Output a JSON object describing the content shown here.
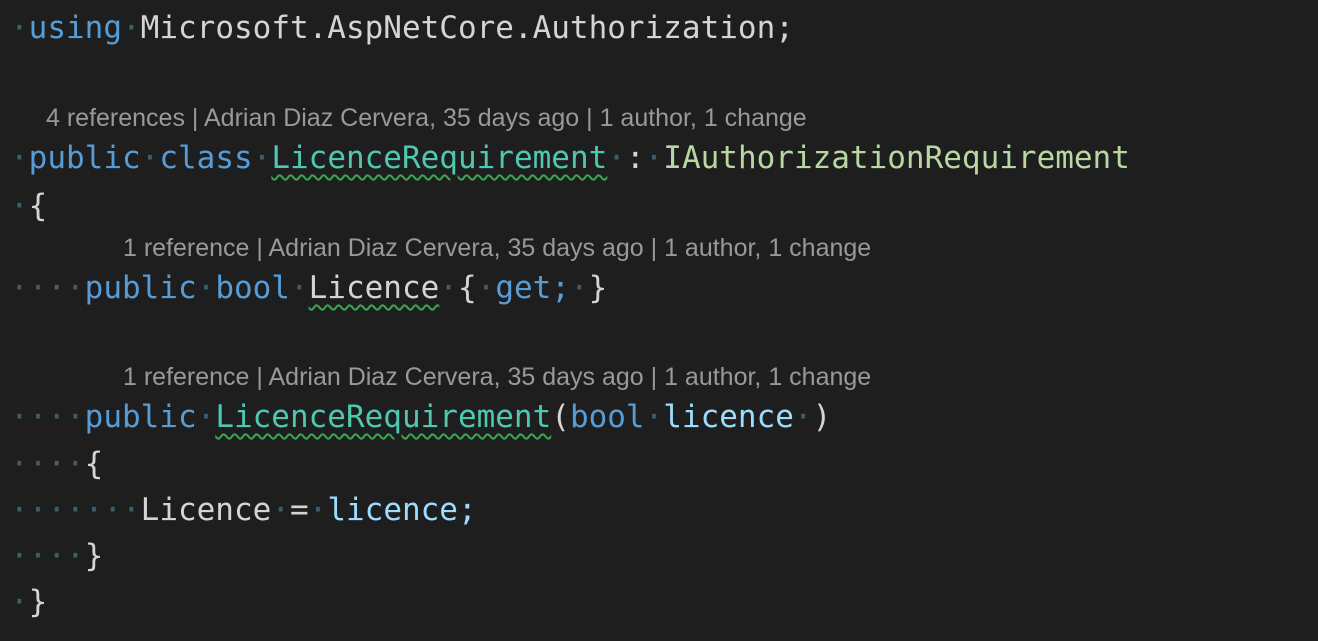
{
  "code": {
    "using_line": {
      "keyword": "using",
      "namespace": "Microsoft.AspNetCore.Authorization;"
    },
    "class_lens": {
      "references": "4 references",
      "author_info": "Adrian Diaz Cervera, 35 days ago",
      "changes": "1 author, 1 change"
    },
    "class_line": {
      "modifier": "public",
      "keyword": "class",
      "name": "LicenceRequirement",
      "colon": ":",
      "interface": "IAuthorizationRequirement"
    },
    "open_brace": "{",
    "property_lens": {
      "references": "1 reference",
      "author_info": "Adrian Diaz Cervera, 35 days ago",
      "changes": "1 author, 1 change"
    },
    "property_line": {
      "modifier": "public",
      "type": "bool",
      "name": "Licence",
      "open": "{",
      "accessor": "get;",
      "close": "}"
    },
    "ctor_lens": {
      "references": "1 reference",
      "author_info": "Adrian Diaz Cervera, 35 days ago",
      "changes": "1 author, 1 change"
    },
    "ctor_line": {
      "modifier": "public",
      "name": "LicenceRequirement",
      "open_paren": "(",
      "param_type": "bool",
      "param_name": "licence",
      "close_paren": ")"
    },
    "ctor_open_brace": "{",
    "assign_line": {
      "target": "Licence",
      "op": "=",
      "value": "licence;"
    },
    "ctor_close_brace": "}",
    "close_brace": "}"
  },
  "colors": {
    "background": "#1e1e1e",
    "keyword": "#569cd6",
    "type": "#4ec9b0",
    "interface": "#b8d7a3",
    "variable": "#9cdcfe",
    "codelens": "#999999",
    "whitespace_dots": "#3b5f6f",
    "squiggle": "#3aa655"
  }
}
